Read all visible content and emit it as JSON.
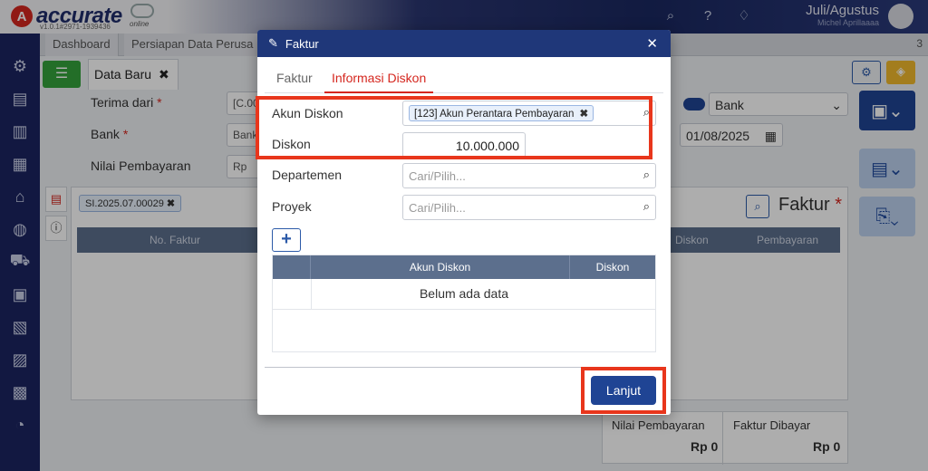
{
  "app": {
    "brand_letter": "A",
    "brand_name": "accurate",
    "version": "v1.0.1#2971-1939436",
    "online": "online",
    "user_name": "Juli/Agustus",
    "user_sub": "Michel Aprillaaaa"
  },
  "tabs": [
    {
      "label": "Dashboard"
    },
    {
      "label": "Persiapan Data Perusa"
    }
  ],
  "tab_count": "3",
  "doc_tab": {
    "label": "Data Baru"
  },
  "form": {
    "terima_dari_label": "Terima dari",
    "terima_dari_value": "[C.00",
    "bank_label": "Bank",
    "bank_value": "Bank",
    "nilai_label": "Nilai Pembayaran",
    "nilai_value": "Rp",
    "bank_select": "Bank",
    "date": "01/08/2025",
    "invoice_chip": "SI.2025.07.00029",
    "faktur_title": "Faktur",
    "table_cols": [
      "No. Faktur",
      "Diskon",
      "Pembayaran"
    ]
  },
  "summary": {
    "nilai_label": "Nilai Pembayaran",
    "nilai_value": "Rp 0",
    "dibayar_label": "Faktur Dibayar",
    "dibayar_value": "Rp 0"
  },
  "modal": {
    "title": "Faktur",
    "tabs": [
      "Faktur",
      "Informasi Diskon"
    ],
    "akun_diskon_label": "Akun Diskon",
    "akun_diskon_chip": "[123] Akun Perantara Pembayaran",
    "diskon_label": "Diskon",
    "diskon_value": "10.000.000",
    "departemen_label": "Departemen",
    "departemen_placeholder": "Cari/Pilih...",
    "proyek_label": "Proyek",
    "proyek_placeholder": "Cari/Pilih...",
    "table_cols": [
      "Akun Diskon",
      "Diskon"
    ],
    "empty_text": "Belum ada data",
    "lanjut_label": "Lanjut"
  },
  "colors": {
    "highlight": "#e8361c",
    "primary": "#1f3779",
    "active_tab": "#d5271f"
  }
}
